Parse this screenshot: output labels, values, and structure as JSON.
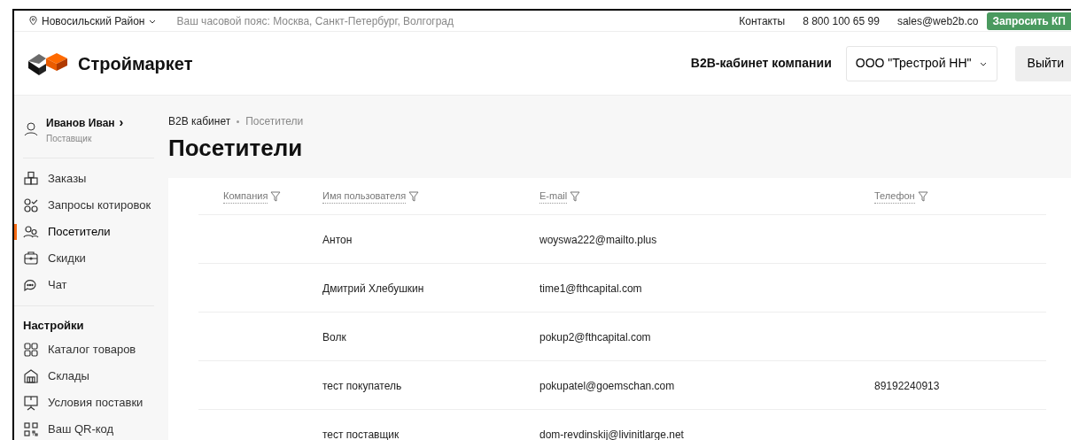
{
  "topbar": {
    "region": "Новосильский Район",
    "timezone": "Ваш часовой пояс: Москва, Санкт-Петербург, Волгоград",
    "contacts": "Контакты",
    "phone": "8 800 100 65 99",
    "email": "sales@web2b.co",
    "request_button": "Запросить КП"
  },
  "header": {
    "logo": "Строймаркет",
    "cabinet_label": "B2B-кабинет компании",
    "company_select": "ООО \"Трестрой НН\"",
    "logout": "Выйти"
  },
  "user": {
    "name": "Иванов Иван",
    "arrow": "›",
    "role": "Поставщик"
  },
  "sidebar": {
    "items": [
      {
        "label": "Заказы",
        "selected": false
      },
      {
        "label": "Запросы котировок",
        "selected": false
      },
      {
        "label": "Посетители",
        "selected": true
      },
      {
        "label": "Скидки",
        "selected": false
      },
      {
        "label": "Чат",
        "selected": false
      }
    ],
    "settings_title": "Настройки",
    "settings_items": [
      {
        "label": "Каталог товаров",
        "selected": false
      },
      {
        "label": "Склады",
        "selected": false
      },
      {
        "label": "Условия поставки",
        "selected": false
      },
      {
        "label": "Ваш QR-код",
        "selected": false
      }
    ]
  },
  "breadcrumbs": [
    "B2B кабинет",
    "Посетители"
  ],
  "page_title": "Посетители",
  "table": {
    "columns": [
      "Компания",
      "Имя пользователя",
      "E-mail",
      "Телефон"
    ],
    "rows": [
      [
        "",
        "Антон",
        "woyswa222@mailto.plus",
        ""
      ],
      [
        "",
        "Дмитрий Хлебушкин",
        "time1@fthcapital.com",
        ""
      ],
      [
        "",
        "Волк",
        "pokup2@fthcapital.com",
        ""
      ],
      [
        "",
        "тест покупатель",
        "pokupatel@goemschan.com",
        "89192240913"
      ],
      [
        "",
        "тест поставщик",
        "dom-revdinskij@livinitlarge.net",
        ""
      ]
    ]
  }
}
